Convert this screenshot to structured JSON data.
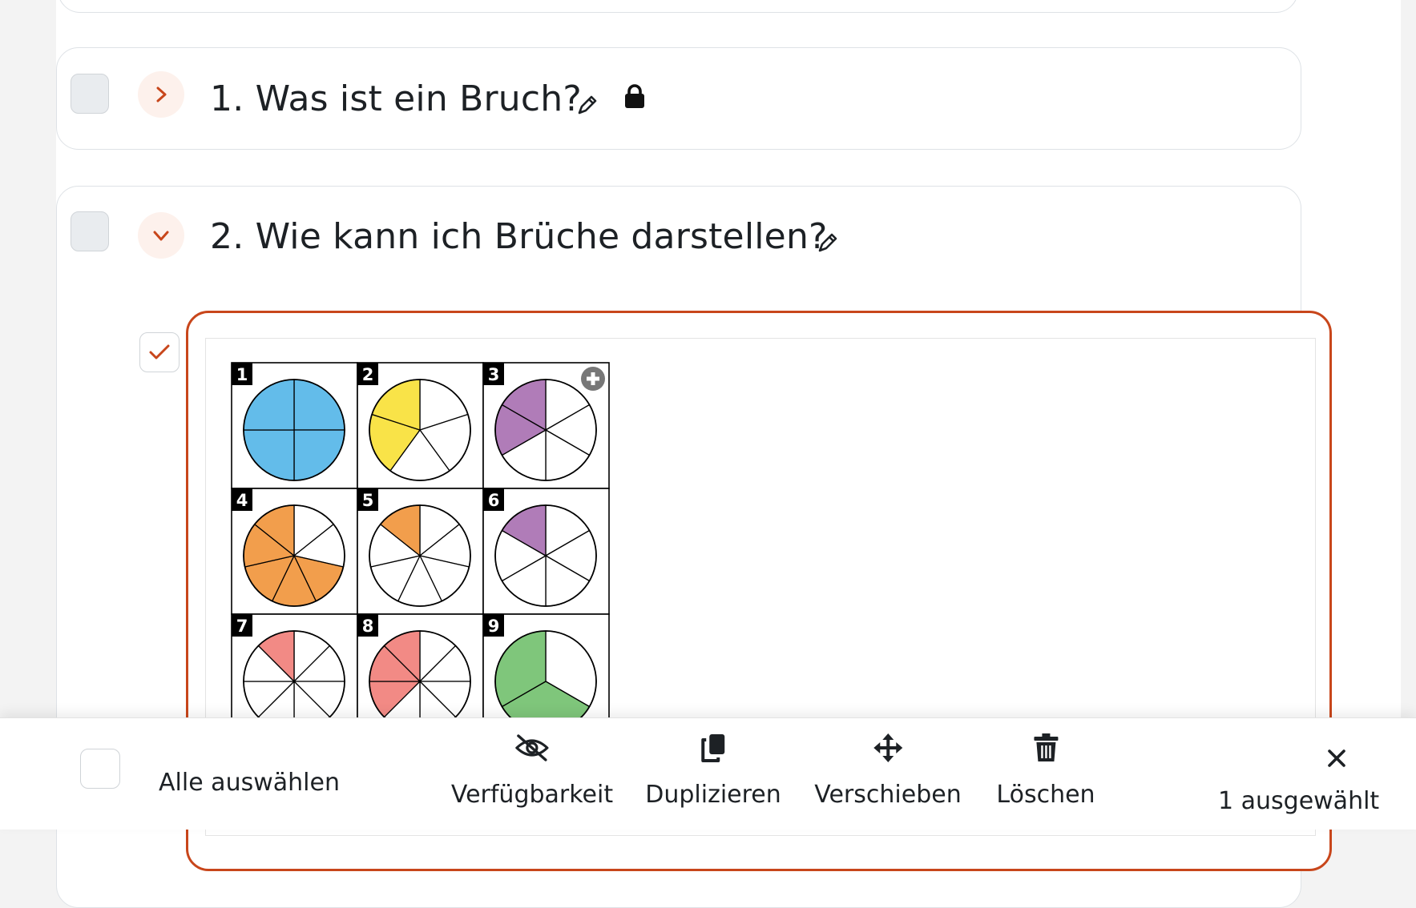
{
  "sections": [
    {
      "title": "1. Was ist ein Bruch?",
      "expanded": false,
      "locked": true
    },
    {
      "title": "2. Wie kann ich Brüche darstellen?",
      "expanded": true,
      "locked": false
    }
  ],
  "figure": {
    "cells": [
      {
        "number": "1",
        "slices": 4,
        "filled": 4,
        "color": "#63bcea"
      },
      {
        "number": "2",
        "slices": 5,
        "filled": 2,
        "color": "#f9e348"
      },
      {
        "number": "3",
        "slices": 6,
        "filled": 2,
        "color": "#b07cb8"
      },
      {
        "number": "4",
        "slices": 7,
        "filled": 5,
        "color": "#f29e4c"
      },
      {
        "number": "5",
        "slices": 7,
        "filled": 1,
        "color": "#f29e4c"
      },
      {
        "number": "6",
        "slices": 6,
        "filled": 1,
        "color": "#b07cb8"
      },
      {
        "number": "7",
        "slices": 8,
        "filled": 1,
        "color": "#f28a85"
      },
      {
        "number": "8",
        "slices": 8,
        "filled": 3,
        "color": "#f28a85"
      },
      {
        "number": "9",
        "slices": 3,
        "filled": 2,
        "color": "#7fc67b"
      }
    ],
    "zoom_icon": "plus-circle-icon"
  },
  "bulk_edit": {
    "select_all_label": "Alle auswählen",
    "actions": [
      {
        "label": "Verfügbarkeit",
        "icon": "eye-slash-icon"
      },
      {
        "label": "Duplizieren",
        "icon": "copy-icon"
      },
      {
        "label": "Verschieben",
        "icon": "move-arrows-icon"
      },
      {
        "label": "Löschen",
        "icon": "trash-icon"
      }
    ],
    "selected_count": "1 ausgewählt",
    "close_icon": "close-icon"
  },
  "colors": {
    "accent": "#c8461b",
    "toggle_bg": "#fdf1ec"
  }
}
